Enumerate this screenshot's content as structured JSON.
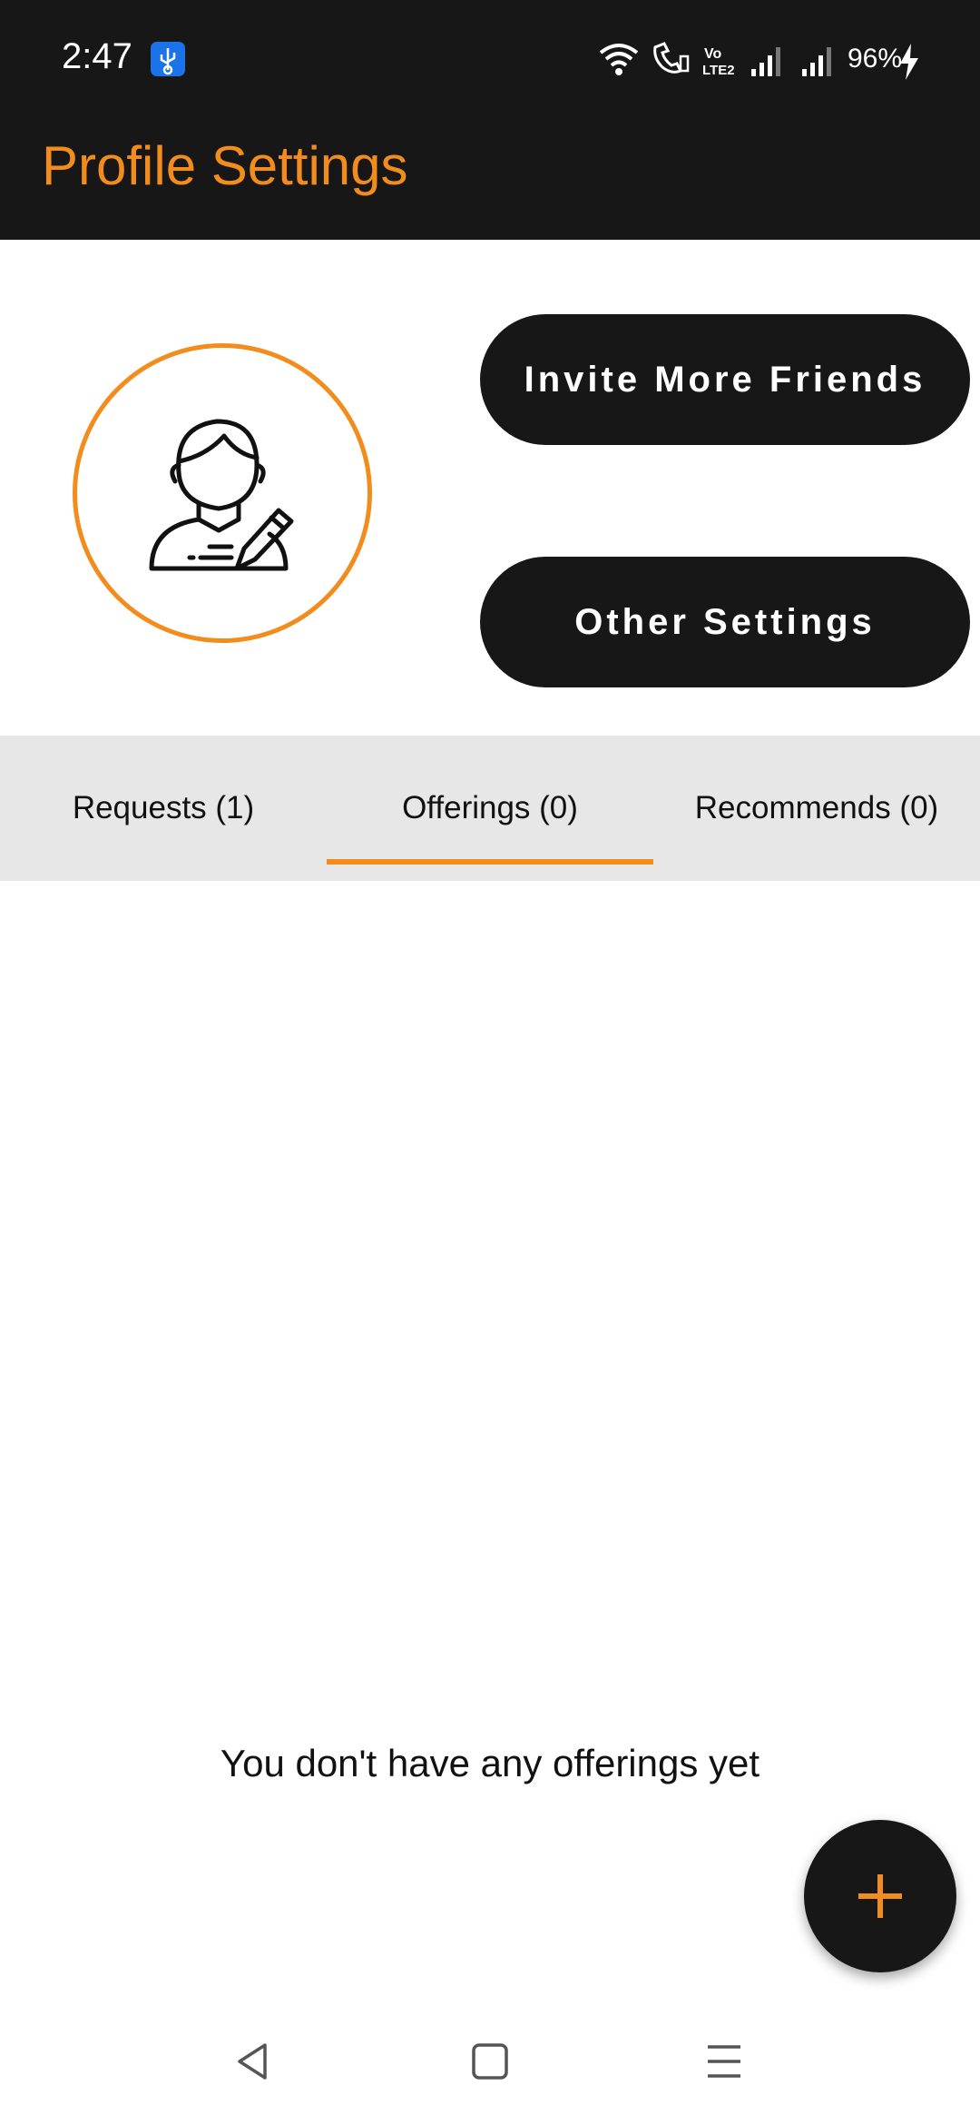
{
  "status_bar": {
    "time": "2:47",
    "battery_percent": "96%",
    "icons": [
      "usb-icon",
      "wifi-icon",
      "wifi-call-icon",
      "volte-icon",
      "signal-icon",
      "signal-icon",
      "charging-icon"
    ]
  },
  "app_bar": {
    "title": "Profile Settings"
  },
  "profile": {
    "avatar_icon": "user-edit-icon",
    "invite_button": "Invite More Friends",
    "settings_button": "Other Settings"
  },
  "tabs": [
    {
      "label": "Requests (1)",
      "selected": false
    },
    {
      "label": "Offerings (0)",
      "selected": true
    },
    {
      "label": "Recommends (0)",
      "selected": false
    }
  ],
  "empty_message": "You don't have any offerings yet",
  "fab": {
    "icon": "plus-icon"
  },
  "nav_bar": [
    "back-icon",
    "home-icon",
    "menu-icon"
  ],
  "colors": {
    "accent": "#f28c1c",
    "dark": "#171717",
    "tab_bg": "#e7e7e7"
  }
}
